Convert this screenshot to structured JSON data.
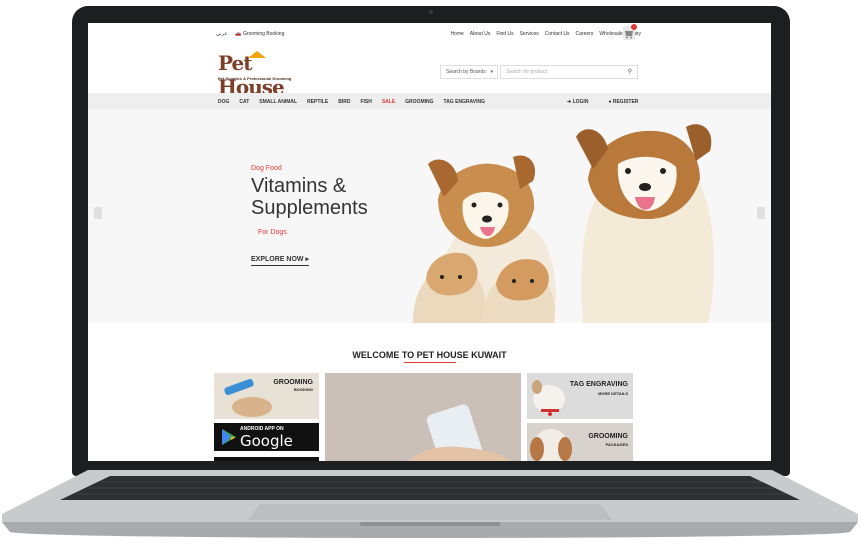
{
  "utility": {
    "arabic": "عربي",
    "grooming_booking": "Grooming Booking",
    "links": [
      "Home",
      "About Us",
      "Find Us",
      "Services",
      "Contact Us",
      "Careers",
      "Wholesale Enquiry"
    ]
  },
  "logo": {
    "name": "Pet House",
    "tagline": "Pet Supplies & Professional Grooming"
  },
  "search": {
    "brand_select": "Search by Brands",
    "placeholder": "Search for product"
  },
  "nav": {
    "items": [
      "DOG",
      "CAT",
      "SMALL ANIMAL",
      "REPTILE",
      "BIRD",
      "FISH",
      "SALE",
      "GROOMING",
      "TAG ENGRAVING"
    ],
    "login": "LOGIN",
    "register": "REGISTER"
  },
  "hero": {
    "kicker": "Dog Food",
    "title": "Vitamins & Supplements",
    "subtitle": "For Dogs",
    "cta": "EXPLORE NOW"
  },
  "welcome": {
    "heading": "WELCOME TO PET HOUSE KUWAIT"
  },
  "tiles": {
    "grooming_booking": {
      "title": "GROOMING",
      "sub": "BOOKING"
    },
    "android": {
      "small": "ANDROID APP ON",
      "big": "Google play"
    },
    "tag_engraving": {
      "title": "TAG ENGRAVING",
      "sub": "MORE DETAILS"
    },
    "grooming_packages": {
      "title": "GROOMING",
      "sub": "PACKAGES"
    }
  },
  "colors": {
    "accent": "#e53935",
    "logo_brown": "#7b3f2a",
    "logo_orange": "#f4a30b",
    "nav_bg": "#eeeeee"
  }
}
